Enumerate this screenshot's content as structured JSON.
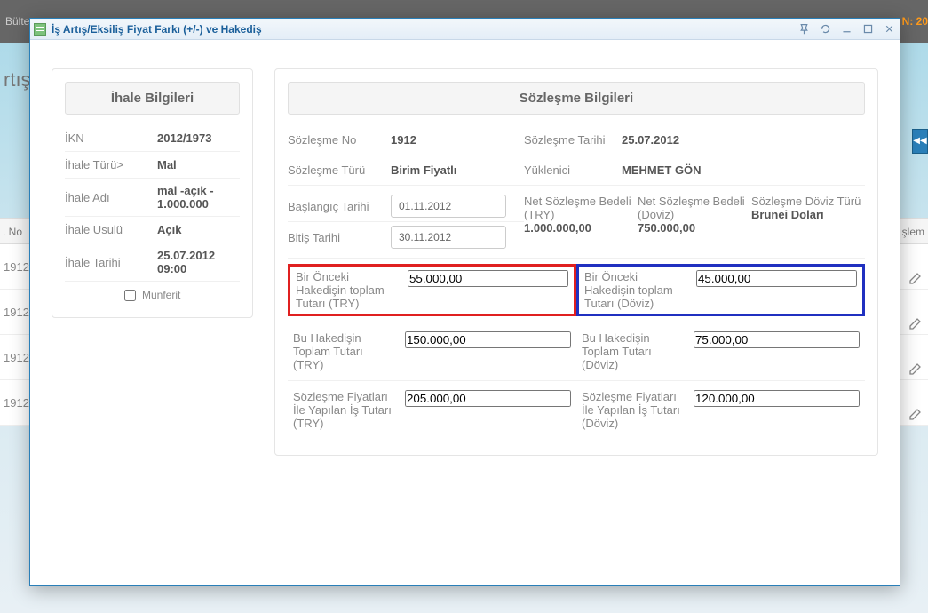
{
  "background": {
    "topbar_left": "Bülte",
    "topbar_right": "N: 20",
    "side_text": "rtış/",
    "list_header_left": ". No",
    "list_header_right": "şlem",
    "row_val": "1912"
  },
  "window": {
    "title": "İş Artış/Eksiliş Fiyat Farkı (+/-) ve Hakediş"
  },
  "left": {
    "header": "İhale Bilgileri",
    "ikn_label": "İKN",
    "ikn_value": "2012/1973",
    "tur_label": "İhale Türü>",
    "tur_value": "Mal",
    "ad_label": "İhale Adı",
    "ad_value": "mal -açık - 1.000.000",
    "usul_label": "İhale Usulü",
    "usul_value": "Açık",
    "tarih_label": "İhale Tarihi",
    "tarih_value": "25.07.2012 09:00",
    "munferit": "Munferit"
  },
  "right": {
    "header": "Sözleşme Bilgileri",
    "soz_no_label": "Sözleşme No",
    "soz_no_value": "1912",
    "soz_tarih_label": "Sözleşme Tarihi",
    "soz_tarih_value": "25.07.2012",
    "soz_tur_label": "Sözleşme Türü",
    "soz_tur_value": "Birim Fiyatlı",
    "yuklenici_label": "Yüklenici",
    "yuklenici_value": "MEHMET GÖN",
    "bas_tarih_label": "Başlangıç Tarihi",
    "bas_tarih_value": "01.11.2012",
    "bit_tarih_label": "Bitiş Tarihi",
    "bit_tarih_value": "30.11.2012",
    "net_try_label": "Net Sözleşme Bedeli (TRY)",
    "net_try_value": "1.000.000,00",
    "net_doviz_label": "Net Sözleşme Bedeli (Döviz)",
    "net_doviz_value": "750.000,00",
    "doviz_tur_label": "Sözleşme Döviz Türü",
    "doviz_tur_value": "Brunei Doları",
    "prev_try_label": "Bir Önceki Hakedişin toplam Tutarı (TRY)",
    "prev_try_value": "55.000,00",
    "prev_doviz_label": "Bir Önceki Hakedişin toplam Tutarı (Döviz)",
    "prev_doviz_value": "45.000,00",
    "cur_try_label": "Bu Hakedişin Toplam Tutarı (TRY)",
    "cur_try_value": "150.000,00",
    "cur_doviz_label": "Bu Hakedişin Toplam Tutarı (Döviz)",
    "cur_doviz_value": "75.000,00",
    "work_try_label": "Sözleşme Fiyatları İle Yapılan İş Tutarı (TRY)",
    "work_try_value": "205.000,00",
    "work_doviz_label": "Sözleşme Fiyatları İle Yapılan İş Tutarı (Döviz)",
    "work_doviz_value": "120.000,00"
  }
}
